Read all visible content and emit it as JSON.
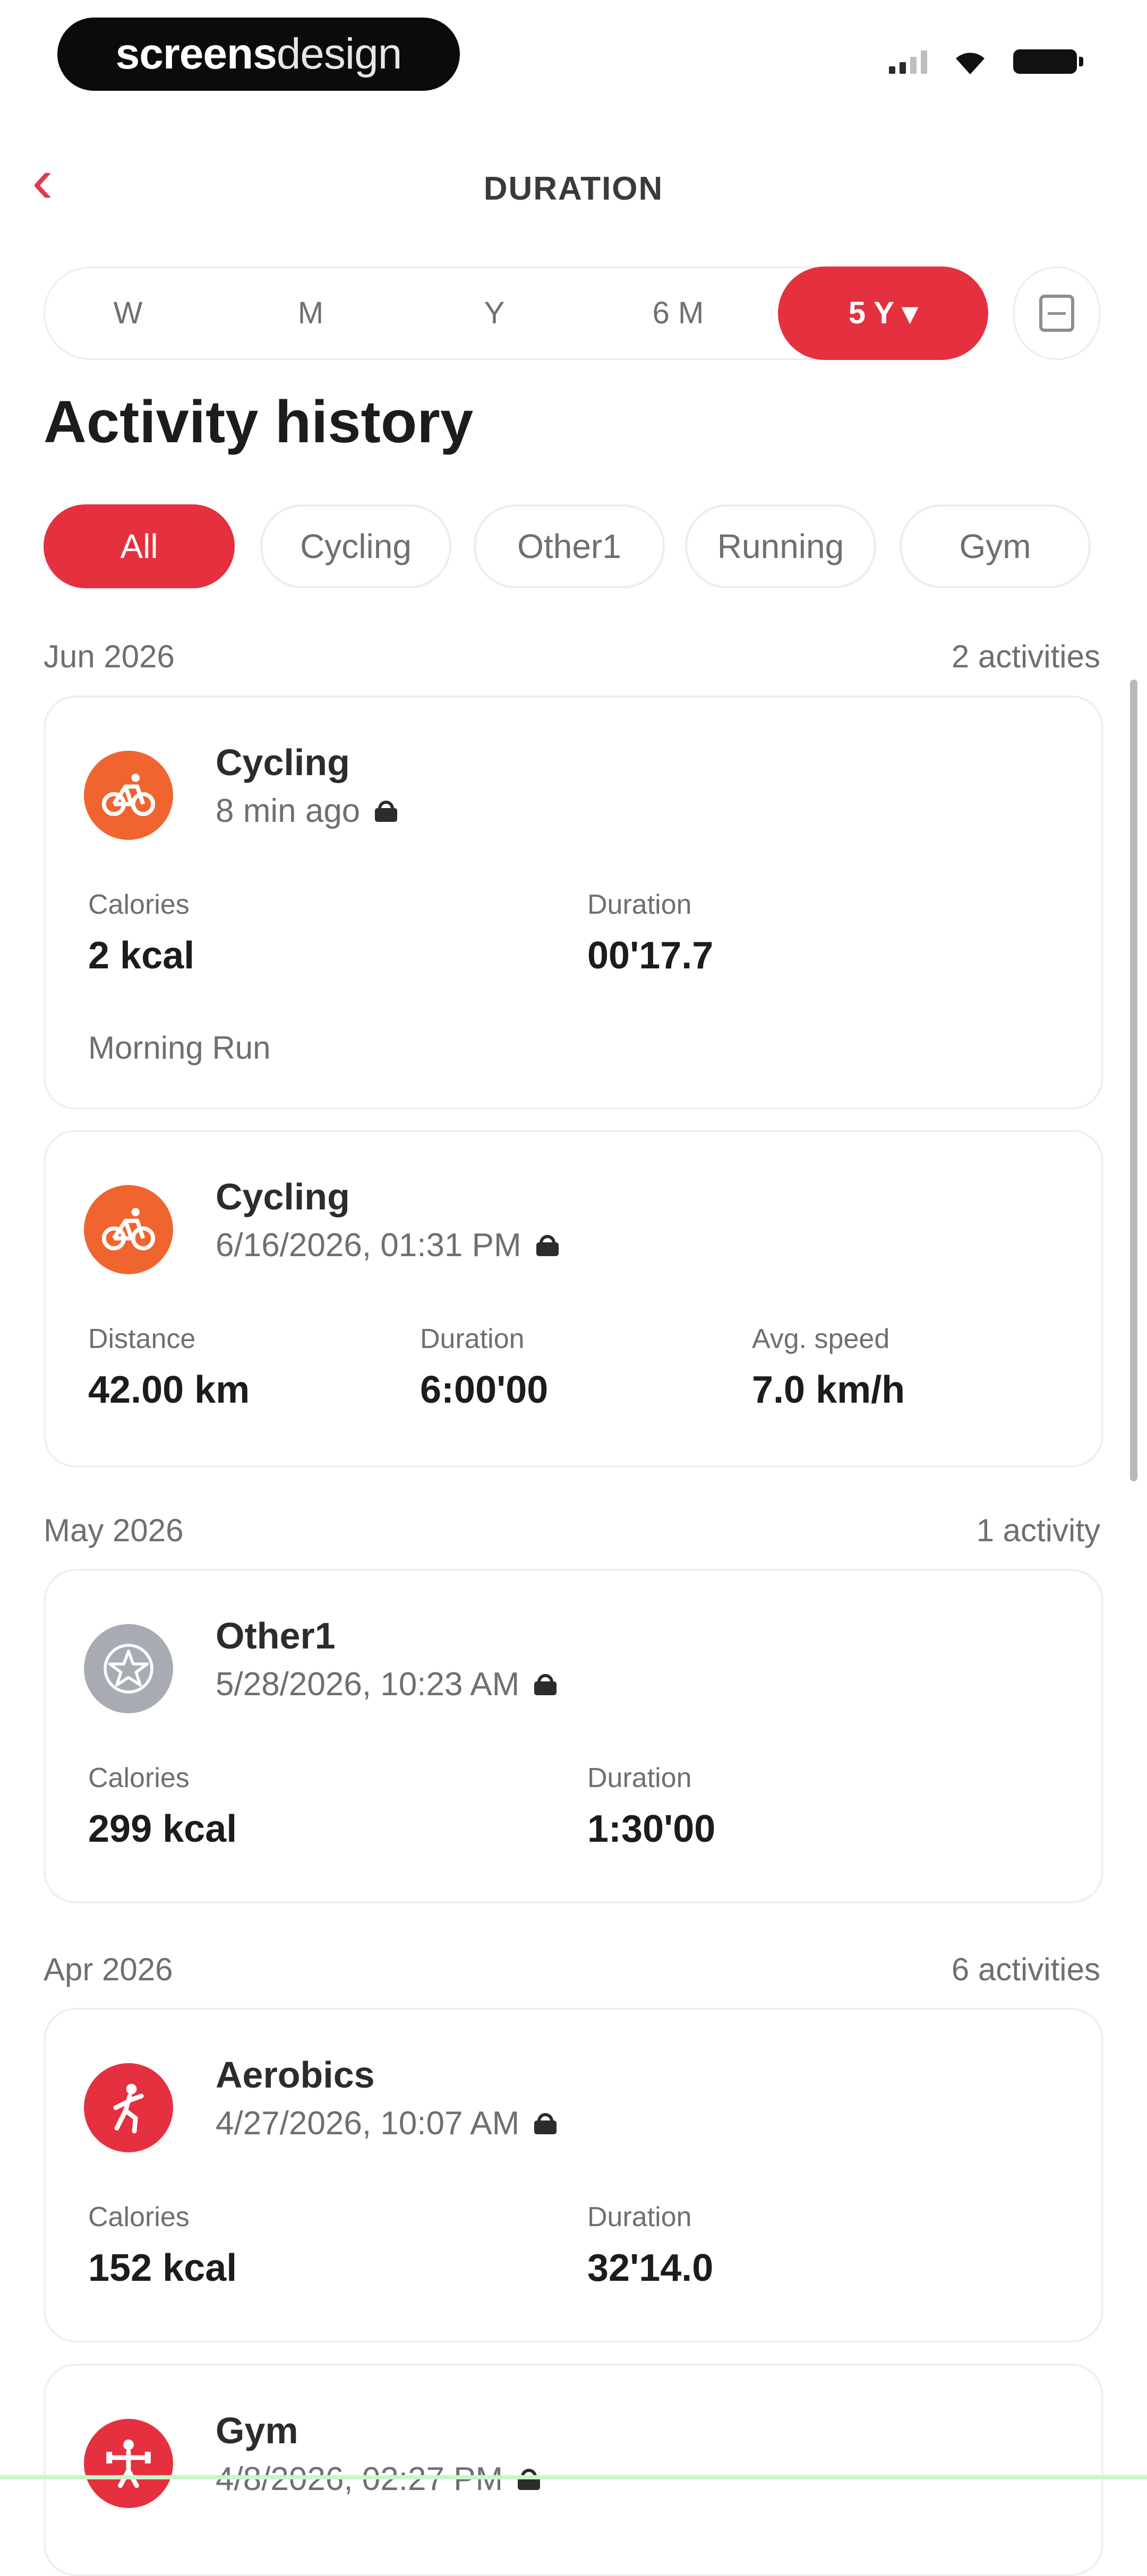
{
  "brand": {
    "bold": "screens",
    "light": "design"
  },
  "header": {
    "title": "DURATION"
  },
  "periods": [
    "W",
    "M",
    "Y",
    "6 M",
    "5 Y ▾"
  ],
  "page_title": "Activity history",
  "filters": [
    "All",
    "Cycling",
    "Other1",
    "Running",
    "Gym"
  ],
  "groups": [
    {
      "date": "Jun 2026",
      "count": "2 activities"
    },
    {
      "date": "May 2026",
      "count": "1 activity"
    },
    {
      "date": "Apr 2026",
      "count": "6 activities"
    }
  ],
  "cards": [
    {
      "name": "Cycling",
      "time": "8 min ago",
      "stats": [
        {
          "label": "Calories",
          "value": "2 kcal"
        },
        {
          "label": "Duration",
          "value": "00'17.7"
        }
      ],
      "note": "Morning Run",
      "icon_color": "#f0652f",
      "icon": "bike-icon"
    },
    {
      "name": "Cycling",
      "time": "6/16/2026, 01:31 PM",
      "stats": [
        {
          "label": "Distance",
          "value": "42.00 km"
        },
        {
          "label": "Duration",
          "value": "6:00'00"
        },
        {
          "label": "Avg. speed",
          "value": "7.0 km/h"
        }
      ],
      "icon_color": "#f0652f",
      "icon": "bike-icon"
    },
    {
      "name": "Other1",
      "time": "5/28/2026, 10:23 AM",
      "stats": [
        {
          "label": "Calories",
          "value": "299 kcal"
        },
        {
          "label": "Duration",
          "value": "1:30'00"
        }
      ],
      "icon_color": "#a9abb4",
      "icon": "star-icon"
    },
    {
      "name": "Aerobics",
      "time": "4/27/2026, 10:07 AM",
      "stats": [
        {
          "label": "Calories",
          "value": "152 kcal"
        },
        {
          "label": "Duration",
          "value": "32'14.0"
        }
      ],
      "icon_color": "#e5303f",
      "icon": "aerobics-icon"
    },
    {
      "name": "Gym",
      "time": "4/8/2026, 02:27 PM",
      "icon_color": "#e5303f",
      "icon": "gym-icon"
    }
  ],
  "colors": {
    "accent": "#e5303f",
    "cycling": "#f0652f",
    "other": "#a9abb4"
  }
}
